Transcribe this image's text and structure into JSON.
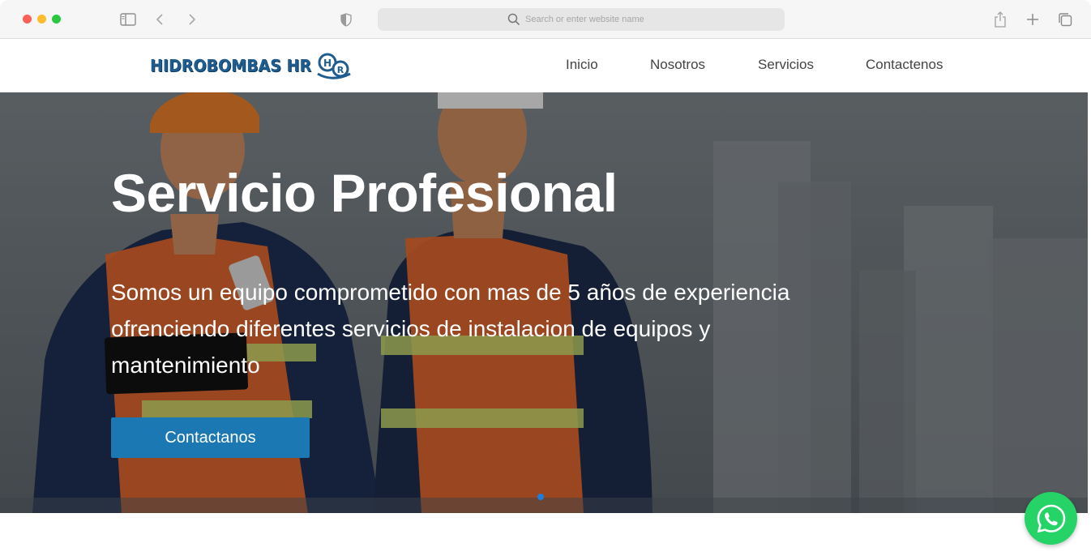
{
  "browser": {
    "address_placeholder": "Search or enter website name"
  },
  "header": {
    "logo_text": "HIDROBOMBAS HR",
    "logo_mark_letters": [
      "H",
      "R"
    ],
    "nav": [
      {
        "label": "Inicio"
      },
      {
        "label": "Nosotros"
      },
      {
        "label": "Servicios"
      },
      {
        "label": "Contactenos"
      }
    ]
  },
  "hero": {
    "title": "Servicio Profesional",
    "text": "Somos un equipo comprometido con mas de 5 años de experiencia ofrenciendo diferentes servicios de instalacion de equipos y mantenimiento",
    "button_label": "Contactanos",
    "carousel_active_index": 0,
    "carousel_count": 1
  },
  "floating": {
    "whatsapp_icon": "whatsapp-icon"
  },
  "colors": {
    "brand_blue": "#1f5d8f",
    "button_blue": "#1c78b3",
    "whatsapp_green": "#25d366",
    "vest_orange": "#e8672b"
  }
}
